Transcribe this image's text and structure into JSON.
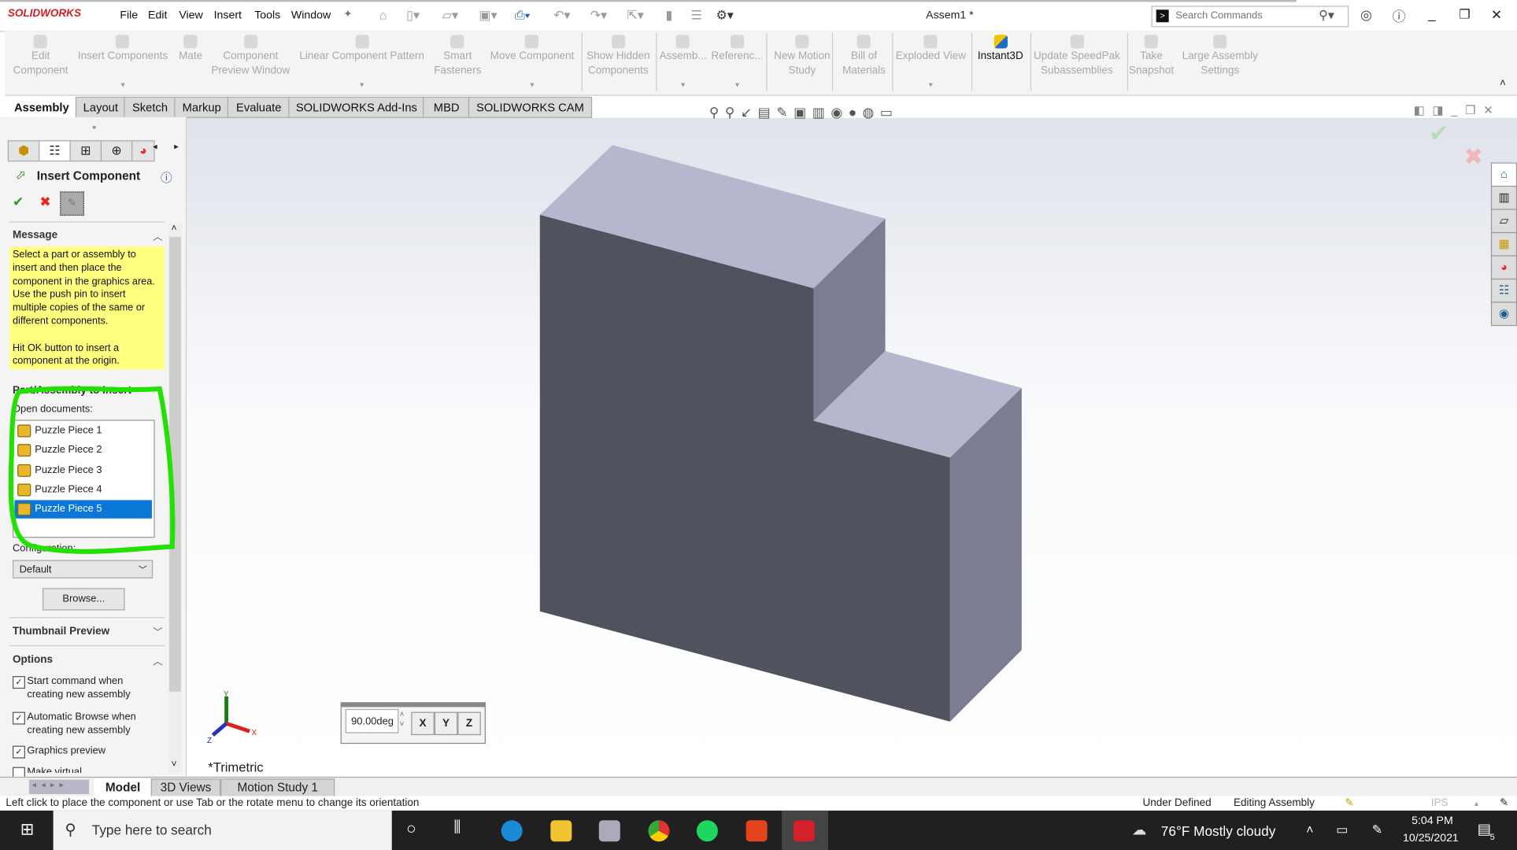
{
  "app": {
    "logo_text": "SOLIDWORKS",
    "document_title": "Assem1 *"
  },
  "menu": [
    "File",
    "Edit",
    "View",
    "Insert",
    "Tools",
    "Window"
  ],
  "search": {
    "placeholder": "Search Commands"
  },
  "ribbon": [
    {
      "lines": [
        "Edit",
        "Component"
      ],
      "dropdown": false,
      "active": false
    },
    {
      "lines": [
        "Insert Components"
      ],
      "dropdown": true,
      "active": false
    },
    {
      "lines": [
        "Mate"
      ],
      "dropdown": false,
      "active": false
    },
    {
      "lines": [
        "Component",
        "Preview Window"
      ],
      "dropdown": false,
      "active": false
    },
    {
      "lines": [
        "Linear Component Pattern"
      ],
      "dropdown": true,
      "active": false
    },
    {
      "lines": [
        "Smart",
        "Fasteners"
      ],
      "dropdown": false,
      "active": false
    },
    {
      "lines": [
        "Move Component"
      ],
      "dropdown": true,
      "active": false
    },
    {
      "lines": [
        "Show Hidden",
        "Components"
      ],
      "dropdown": false,
      "active": false
    },
    {
      "lines": [
        "Assemb..."
      ],
      "dropdown": true,
      "active": false
    },
    {
      "lines": [
        "Referenc..."
      ],
      "dropdown": true,
      "active": false
    },
    {
      "lines": [
        "New Motion",
        "Study"
      ],
      "dropdown": false,
      "active": false
    },
    {
      "lines": [
        "Bill of",
        "Materials"
      ],
      "dropdown": false,
      "active": false
    },
    {
      "lines": [
        "Exploded View"
      ],
      "dropdown": true,
      "active": false
    },
    {
      "lines": [
        "Instant3D"
      ],
      "dropdown": false,
      "active": true
    },
    {
      "lines": [
        "Update SpeedPak",
        "Subassemblies"
      ],
      "dropdown": false,
      "active": false
    },
    {
      "lines": [
        "Take",
        "Snapshot"
      ],
      "dropdown": false,
      "active": false
    },
    {
      "lines": [
        "Large Assembly",
        "Settings"
      ],
      "dropdown": false,
      "active": false
    }
  ],
  "command_tabs": [
    "Assembly",
    "Layout",
    "Sketch",
    "Markup",
    "Evaluate",
    "SOLIDWORKS Add-Ins",
    "MBD",
    "SOLIDWORKS CAM"
  ],
  "property_manager": {
    "title": "Insert Component",
    "message_header": "Message",
    "message": "Select a part or assembly to\ninsert and then place the\ncomponent in the graphics area.\nUse the push pin to insert\nmultiple copies of the same or\ndifferent components.\n\nHit OK button to insert a\ncomponent at the origin.",
    "part_section_header": "Part/Assembly to Insert",
    "open_documents_label": "Open documents:",
    "open_documents": [
      "Puzzle Piece 1",
      "Puzzle Piece 2",
      "Puzzle Piece 3",
      "Puzzle Piece 4",
      "Puzzle Piece 5"
    ],
    "selected_index": 4,
    "configuration_label": "Configuration:",
    "configuration_value": "Default",
    "browse_label": "Browse...",
    "thumbnail_header": "Thumbnail Preview",
    "options_header": "Options",
    "options": [
      {
        "label": "Start command when\ncreating new assembly",
        "checked": true
      },
      {
        "label": "Automatic Browse when\ncreating new assembly",
        "checked": true
      },
      {
        "label": "Graphics preview",
        "checked": true
      },
      {
        "label": "Make virtual",
        "checked": false
      }
    ]
  },
  "viewport": {
    "view_name": "*Trimetric",
    "rotate_angle": "90.00deg",
    "rotate_axes": [
      "X",
      "Y",
      "Z"
    ],
    "triad": [
      "X",
      "Y",
      "Z"
    ]
  },
  "bottom_tabs": [
    "Model",
    "3D Views",
    "Motion Study 1"
  ],
  "status": {
    "hint": "Left click to place the component or use Tab or the rotate menu to change its orientation",
    "state": "Under Defined",
    "mode": "Editing Assembly",
    "units": "IPS"
  },
  "taskbar": {
    "search_placeholder": "Type here to search",
    "weather": "76°F  Mostly cloudy",
    "time": "5:04 PM",
    "date": "10/25/2021",
    "notifications": "5"
  },
  "colors": {
    "highlight": "#0b78d7",
    "message_bg": "#ffff80",
    "annotation": "#22e000",
    "face_front": "#50525e",
    "face_top": "#b4b7cd",
    "face_side": "#7b7d92"
  }
}
